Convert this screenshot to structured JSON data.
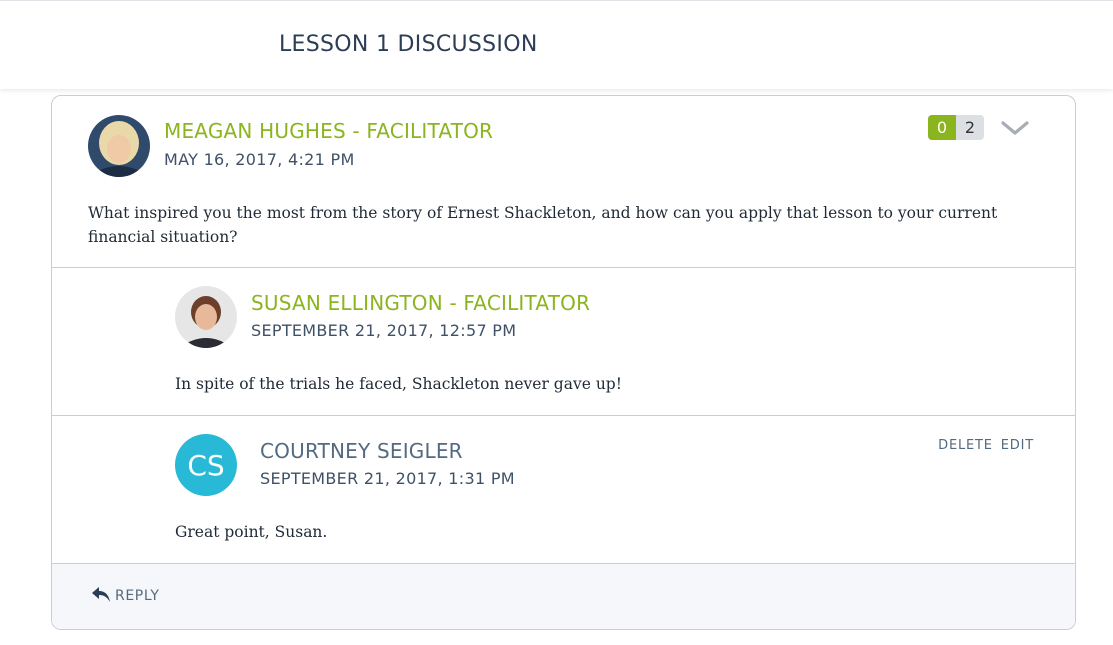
{
  "page": {
    "title": "LESSON 1 DISCUSSION"
  },
  "thread": {
    "main_post": {
      "author": "MEAGAN HUGHES - FACILITATOR",
      "timestamp": "MAY 16, 2017, 4:21 PM",
      "body": "What inspired you the most from the story of Ernest Shackleton, and how can you apply that lesson to your current financial situation?",
      "upvotes": "0",
      "downvotes": "2",
      "avatar_icon": "photo-avatar"
    },
    "replies": [
      {
        "author": "SUSAN ELLINGTON - FACILITATOR",
        "timestamp": "SEPTEMBER 21, 2017, 12:57 PM",
        "body": "In spite of the trials he faced, Shackleton never gave up!",
        "avatar_icon": "photo-avatar"
      },
      {
        "author": "COURTNEY SEIGLER",
        "timestamp": "SEPTEMBER 21, 2017, 1:31 PM",
        "body": "Great point, Susan.",
        "avatar_initials": "CS",
        "avatar_color": "#28b9d6",
        "actions": {
          "delete": "DELETE",
          "edit": "EDIT"
        }
      }
    ],
    "reply_label": "REPLY"
  },
  "colors": {
    "facilitator_name": "#8ab51f",
    "upvote": "#8ab51f",
    "initials_avatar": "#28b9d6"
  }
}
